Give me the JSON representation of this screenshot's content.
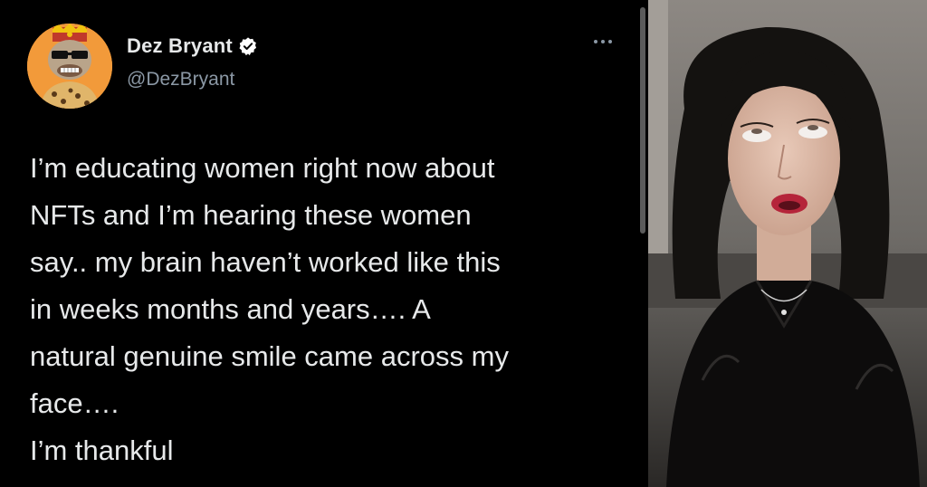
{
  "tweet": {
    "display_name": "Dez Bryant",
    "handle": "@DezBryant",
    "verified": true,
    "avatar_icon": "nft-ape-avatar-icon",
    "more_icon": "more-options-icon",
    "text_lines": [
      "I’m educating women right now about",
      "NFTs and I’m hearing these women",
      "say.. my brain haven’t worked like this",
      "in weeks months and years…. A",
      "natural genuine smile came across my",
      "face….",
      "I’m thankful"
    ]
  },
  "photo": {
    "subject": "woman-rolling-eyes-reaction-photo"
  },
  "colors": {
    "background": "#000000",
    "text_primary": "#e7e9ea",
    "text_secondary": "#8b98a5",
    "verified_badge": "#ffffff",
    "avatar_bg": "#f29a3a"
  }
}
